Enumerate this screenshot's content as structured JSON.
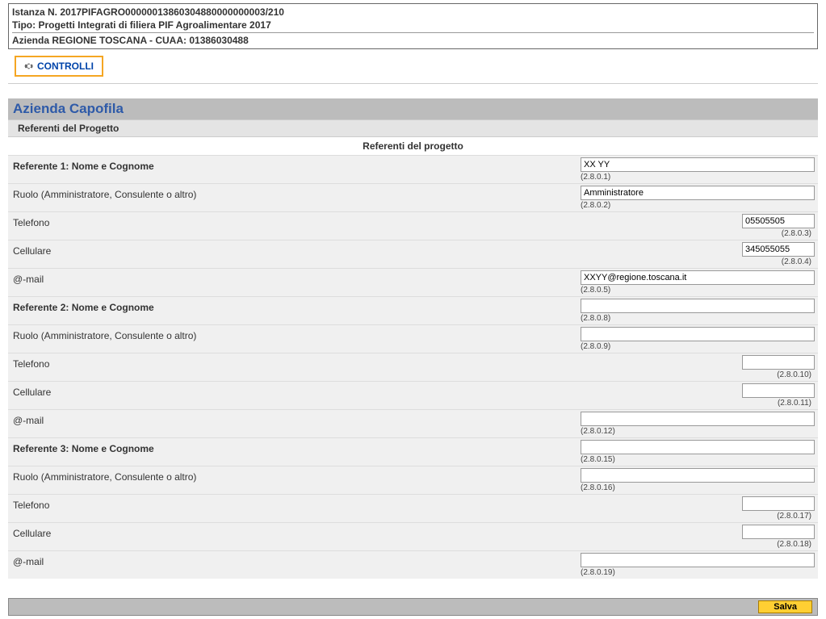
{
  "header": {
    "line1": "Istanza N. 2017PIFAGRO00000013860304880000000003/210",
    "line2": "Tipo: Progetti Integrati di filiera PIF Agroalimentare 2017",
    "line3": "Azienda REGIONE TOSCANA - CUAA: 01386030488"
  },
  "controlli": {
    "label": "CONTROLLI"
  },
  "section": {
    "title": "Azienda Capofila",
    "subtitle": "Referenti del Progetto",
    "table_title": "Referenti del progetto"
  },
  "rows": [
    {
      "label": "Referente 1: Nome e Cognome",
      "bold": true,
      "value": "XX YY",
      "code": "(2.8.0.1)",
      "wide": true
    },
    {
      "label": "Ruolo (Amministratore, Consulente o altro)",
      "bold": false,
      "value": "Amministratore",
      "code": "(2.8.0.2)",
      "wide": true
    },
    {
      "label": "Telefono",
      "bold": false,
      "value": "05505505",
      "code": "(2.8.0.3)",
      "wide": false
    },
    {
      "label": "Cellulare",
      "bold": false,
      "value": "345055055",
      "code": "(2.8.0.4)",
      "wide": false
    },
    {
      "label": "@-mail",
      "bold": false,
      "value": "XXYY@regione.toscana.it",
      "code": "(2.8.0.5)",
      "wide": true
    },
    {
      "label": "Referente 2: Nome e Cognome",
      "bold": true,
      "value": "",
      "code": "(2.8.0.8)",
      "wide": true
    },
    {
      "label": "Ruolo (Amministratore, Consulente o altro)",
      "bold": false,
      "value": "",
      "code": "(2.8.0.9)",
      "wide": true
    },
    {
      "label": "Telefono",
      "bold": false,
      "value": "",
      "code": "(2.8.0.10)",
      "wide": false
    },
    {
      "label": "Cellulare",
      "bold": false,
      "value": "",
      "code": "(2.8.0.11)",
      "wide": false
    },
    {
      "label": "@-mail",
      "bold": false,
      "value": "",
      "code": "(2.8.0.12)",
      "wide": true
    },
    {
      "label": "Referente 3: Nome e Cognome",
      "bold": true,
      "value": "",
      "code": "(2.8.0.15)",
      "wide": true
    },
    {
      "label": "Ruolo (Amministratore, Consulente o altro)",
      "bold": false,
      "value": "",
      "code": "(2.8.0.16)",
      "wide": true
    },
    {
      "label": "Telefono",
      "bold": false,
      "value": "",
      "code": "(2.8.0.17)",
      "wide": false
    },
    {
      "label": "Cellulare",
      "bold": false,
      "value": "",
      "code": "(2.8.0.18)",
      "wide": false
    },
    {
      "label": "@-mail",
      "bold": false,
      "value": "",
      "code": "(2.8.0.19)",
      "wide": true
    }
  ],
  "footer": {
    "save_label": "Salva"
  }
}
